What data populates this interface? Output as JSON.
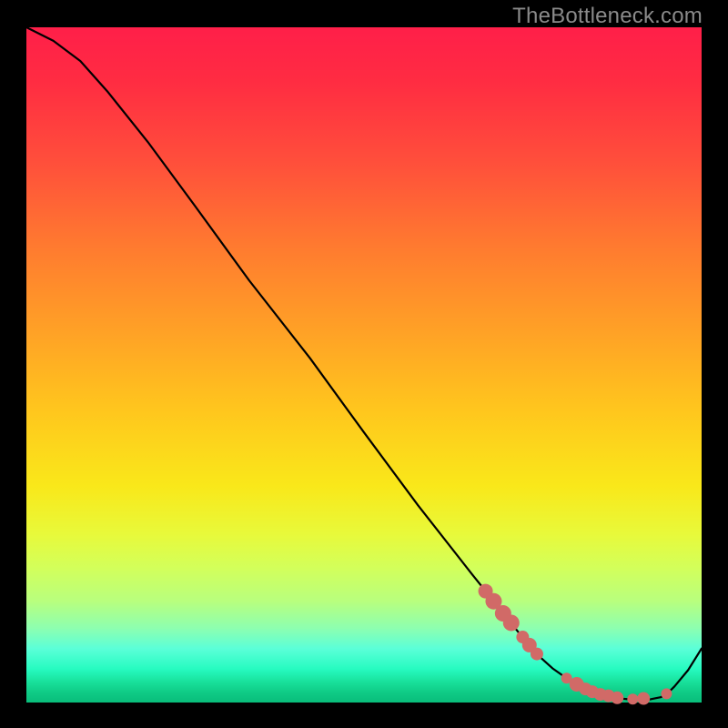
{
  "watermark": "TheBottleneck.com",
  "chart_data": {
    "type": "line",
    "title": "",
    "xlabel": "",
    "ylabel": "",
    "x": [
      0.0,
      0.04,
      0.08,
      0.12,
      0.18,
      0.25,
      0.33,
      0.42,
      0.5,
      0.58,
      0.66,
      0.7,
      0.72,
      0.74,
      0.76,
      0.78,
      0.8,
      0.82,
      0.84,
      0.86,
      0.88,
      0.9,
      0.92,
      0.94,
      0.95,
      0.96,
      0.98,
      1.0
    ],
    "values": [
      1.0,
      0.98,
      0.95,
      0.905,
      0.83,
      0.735,
      0.625,
      0.51,
      0.4,
      0.292,
      0.19,
      0.14,
      0.115,
      0.09,
      0.068,
      0.05,
      0.036,
      0.025,
      0.016,
      0.01,
      0.006,
      0.004,
      0.004,
      0.008,
      0.014,
      0.024,
      0.048,
      0.08
    ],
    "xlim": [
      0,
      1
    ],
    "ylim": [
      0,
      1
    ],
    "grid": false,
    "legend": false,
    "line_color": "#000000",
    "markers": {
      "color": "#d16a67",
      "shape": "circle",
      "points": [
        {
          "x": 0.68,
          "y": 0.165,
          "r": 8
        },
        {
          "x": 0.692,
          "y": 0.15,
          "r": 9
        },
        {
          "x": 0.706,
          "y": 0.132,
          "r": 9
        },
        {
          "x": 0.718,
          "y": 0.118,
          "r": 9
        },
        {
          "x": 0.735,
          "y": 0.097,
          "r": 7
        },
        {
          "x": 0.745,
          "y": 0.085,
          "r": 8
        },
        {
          "x": 0.756,
          "y": 0.072,
          "r": 7
        },
        {
          "x": 0.8,
          "y": 0.036,
          "r": 6
        },
        {
          "x": 0.815,
          "y": 0.027,
          "r": 8
        },
        {
          "x": 0.828,
          "y": 0.02,
          "r": 7
        },
        {
          "x": 0.838,
          "y": 0.016,
          "r": 7
        },
        {
          "x": 0.85,
          "y": 0.012,
          "r": 7
        },
        {
          "x": 0.862,
          "y": 0.01,
          "r": 7
        },
        {
          "x": 0.875,
          "y": 0.007,
          "r": 7
        },
        {
          "x": 0.898,
          "y": 0.005,
          "r": 6
        },
        {
          "x": 0.914,
          "y": 0.006,
          "r": 7
        },
        {
          "x": 0.948,
          "y": 0.013,
          "r": 6
        }
      ]
    }
  }
}
